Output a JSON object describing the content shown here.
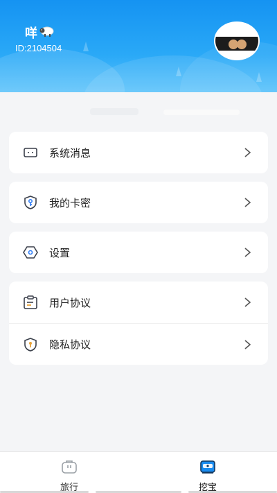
{
  "header": {
    "username": "咩",
    "user_id": "ID:2104504",
    "colors": {
      "gradient_top": "#1593f2",
      "gradient_bottom": "#5cc3fb"
    }
  },
  "menu": {
    "group1": [
      {
        "label": "系统消息",
        "icon": "message-icon"
      }
    ],
    "group2": [
      {
        "label": "我的卡密",
        "icon": "shield-key-icon"
      }
    ],
    "group3": [
      {
        "label": "设置",
        "icon": "settings-icon"
      }
    ],
    "group4": [
      {
        "label": "用户协议",
        "icon": "clipboard-icon"
      },
      {
        "label": "隐私协议",
        "icon": "privacy-shield-icon"
      }
    ]
  },
  "tabbar": {
    "tabs": [
      {
        "label": "旅行",
        "icon": "bag-icon",
        "active": false
      },
      {
        "label": "挖宝",
        "icon": "treasure-icon",
        "active": true
      }
    ],
    "accent": "#1a8cf0"
  }
}
